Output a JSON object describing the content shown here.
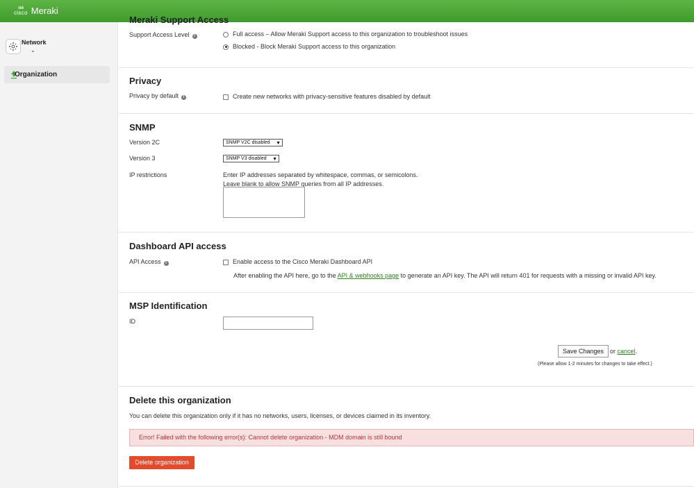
{
  "brand": {
    "cisco": "cisco",
    "name": "Meraki"
  },
  "sidebar": {
    "network_label": "Network",
    "organization_label": "Organization"
  },
  "support": {
    "title_partial": "Meraki Support Access",
    "label": "Support Access Level",
    "options": [
      {
        "text": "Full access – Allow Meraki Support access to this organization to troubleshoot issues",
        "selected": false
      },
      {
        "text": "Blocked - Block Meraki Support access to this organization",
        "selected": true
      }
    ]
  },
  "privacy": {
    "title": "Privacy",
    "label": "Privacy by default",
    "checkbox_text": "Create new networks with privacy-sensitive features disabled by default"
  },
  "snmp": {
    "title": "SNMP",
    "v2c_label": "Version 2C",
    "v2c_value": "SNMP V2C disabled",
    "v3_label": "Version 3",
    "v3_value": "SNMP V3 disabled",
    "ip_label": "IP restrictions",
    "ip_help1": "Enter IP addresses separated by whitespace, commas, or semicolons.",
    "ip_help2": "Leave blank to allow SNMP queries from all IP addresses."
  },
  "api": {
    "title": "Dashboard API access",
    "label": "API Access",
    "checkbox_text": "Enable access to the Cisco Meraki Dashboard API",
    "help_before": "After enabling the API here, go to the ",
    "help_link": "API & webhooks page",
    "help_after": " to generate an API key. The API will return 401 for requests with a missing or invalid API key."
  },
  "msp": {
    "title": "MSP Identification",
    "id_label": "ID"
  },
  "actions": {
    "save": "Save Changes",
    "or": "or",
    "cancel": "cancel",
    "period": ".",
    "note": "(Please allow 1-2 minutes for changes to take effect.)"
  },
  "delete": {
    "title": "Delete this organization",
    "description": "You can delete this organization only if it has no networks, users, licenses, or devices claimed in its inventory.",
    "error": "Error! Failed with the following error(s): Cannot delete organization - MDM domain is still bound",
    "button": "Delete organization"
  },
  "colors": {
    "brand_green": "#4caf3a",
    "danger": "#e24b2c",
    "link": "#2e7d1e"
  }
}
